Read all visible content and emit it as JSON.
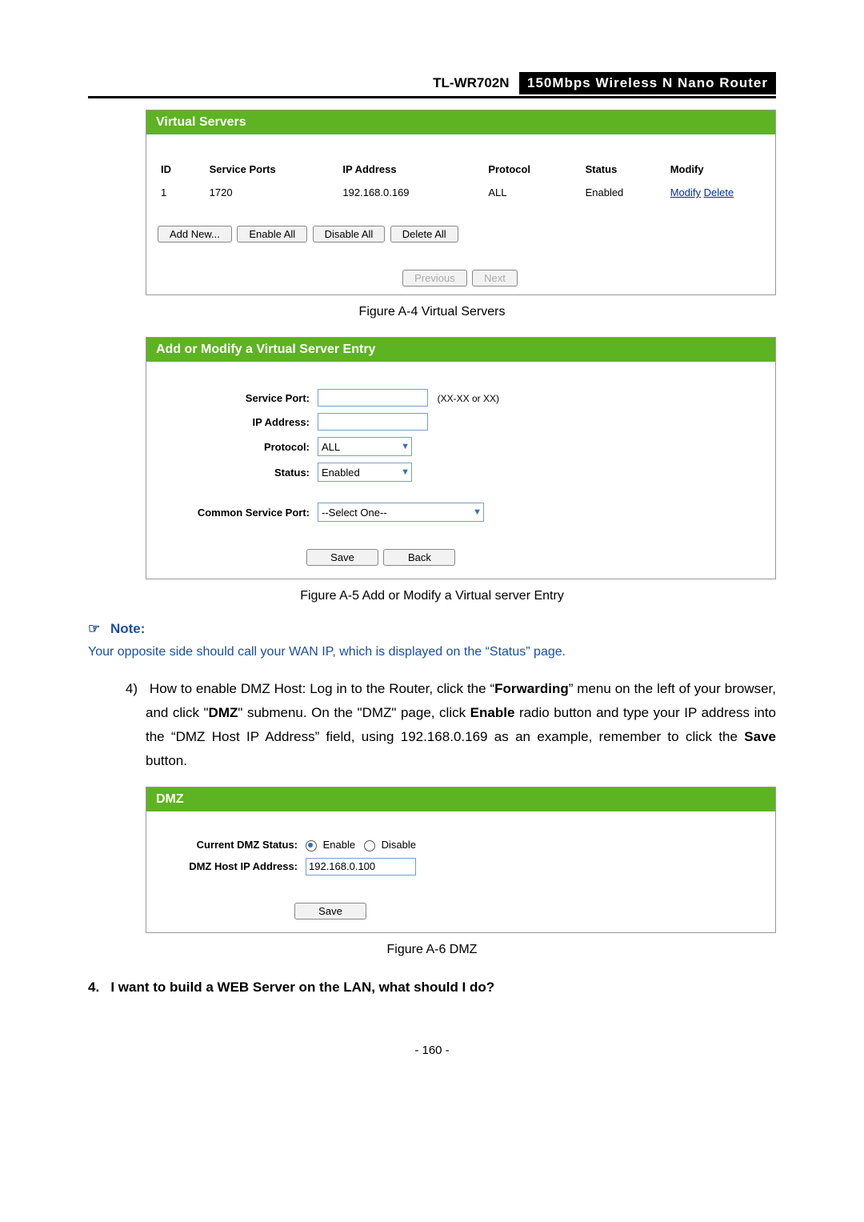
{
  "header": {
    "model": "TL-WR702N",
    "desc": "150Mbps  Wireless  N  Nano  Router"
  },
  "fig_a4": {
    "title": "Virtual Servers",
    "columns": [
      "ID",
      "Service Ports",
      "IP Address",
      "Protocol",
      "Status",
      "Modify"
    ],
    "row": {
      "id": "1",
      "ports": "1720",
      "ip": "192.168.0.169",
      "proto": "ALL",
      "status": "Enabled",
      "mod1": "Modify",
      "mod2": "Delete"
    },
    "btn_addnew": "Add New...",
    "btn_enableall": "Enable All",
    "btn_disableall": "Disable All",
    "btn_deleteall": "Delete All",
    "btn_prev": "Previous",
    "btn_next": "Next",
    "caption": "Figure A-4    Virtual Servers"
  },
  "fig_a5": {
    "title": "Add or Modify a Virtual Server Entry",
    "lbl_service_port": "Service Port:",
    "hint_port": "(XX-XX or XX)",
    "lbl_ip": "IP Address:",
    "lbl_proto": "Protocol:",
    "val_proto": "ALL",
    "lbl_status": "Status:",
    "val_status": "Enabled",
    "lbl_common": "Common Service Port:",
    "val_common": "--Select One--",
    "btn_save": "Save",
    "btn_back": "Back",
    "caption": "Figure A-5    Add or Modify a Virtual server Entry"
  },
  "note": {
    "label": "Note:",
    "text": "Your opposite side should call your WAN IP, which is displayed on the “Status” page."
  },
  "para4": {
    "num": "4)",
    "t1": "How to enable DMZ Host: Log in to the Router, click the “",
    "bold1": "Forwarding",
    "t2": "” menu on the left of your browser, and click \"",
    "bold2": "DMZ",
    "t3": "\" submenu. On the \"DMZ\" page, click ",
    "bold3": "Enable",
    "t4": " radio button and type your IP address into the “DMZ Host IP Address” field, using 192.168.0.169 as an example, remember to click the ",
    "bold4": "Save",
    "t5": " button."
  },
  "fig_a6": {
    "title": "DMZ",
    "lbl_status": "Current DMZ Status:",
    "opt_enable": "Enable",
    "opt_disable": "Disable",
    "lbl_host": "DMZ Host IP Address:",
    "val_host": "192.168.0.100",
    "btn_save": "Save",
    "caption": "Figure A-6    DMZ"
  },
  "q4": {
    "num": "4.",
    "text": "I want to build a WEB Server on the LAN, what should I do?"
  },
  "page_number": "- 160 -"
}
